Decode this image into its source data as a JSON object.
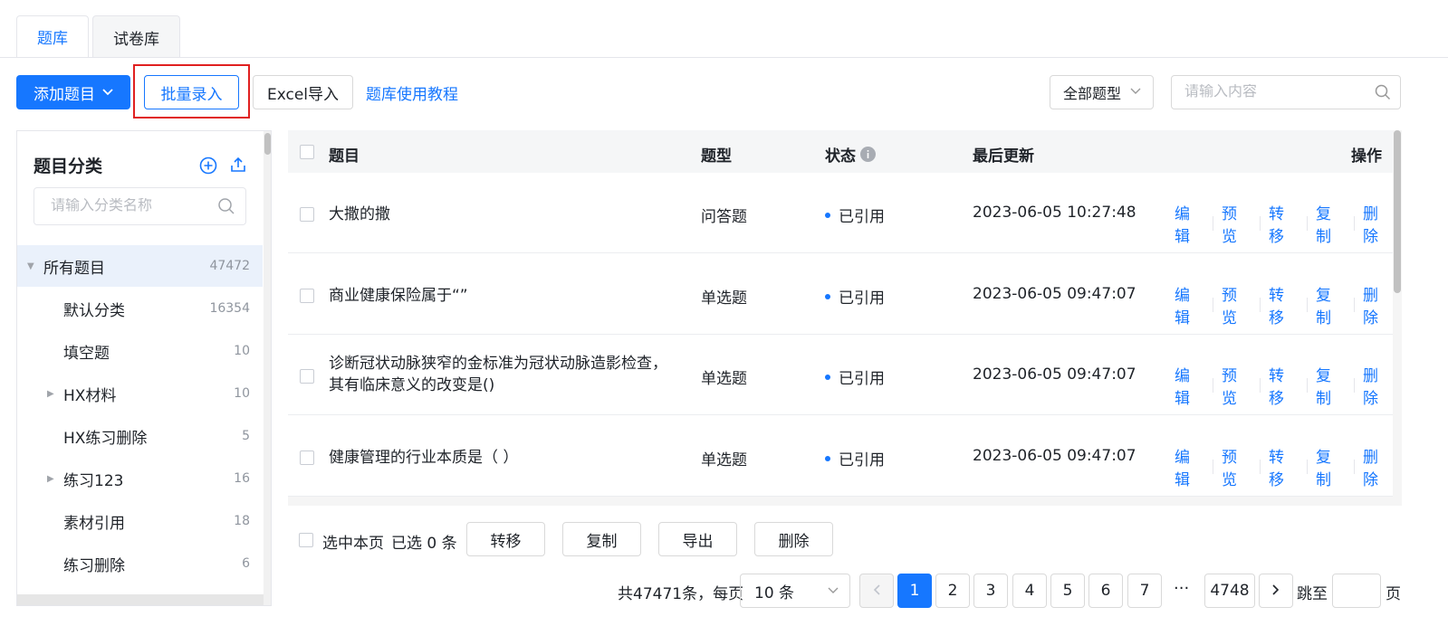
{
  "tabs": [
    {
      "label": "题库",
      "active": true
    },
    {
      "label": "试卷库",
      "active": false
    }
  ],
  "toolbar": {
    "add_label": "添加题目",
    "batch_label": "批量录入",
    "excel_label": "Excel导入",
    "tutorial_label": "题库使用教程",
    "type_filter": "全部题型",
    "search_placeholder": "请输入内容"
  },
  "sidebar": {
    "title": "题目分类",
    "search_placeholder": "请输入分类名称",
    "items": [
      {
        "label": "所有题目",
        "count": "47472"
      },
      {
        "label": "默认分类",
        "count": "16354"
      },
      {
        "label": "填空题",
        "count": "10"
      },
      {
        "label": "HX材料",
        "count": "10"
      },
      {
        "label": "HX练习删除",
        "count": "5"
      },
      {
        "label": "练习123",
        "count": "16"
      },
      {
        "label": "素材引用",
        "count": "18"
      },
      {
        "label": "练习删除",
        "count": "6"
      }
    ]
  },
  "table": {
    "headers": {
      "title": "题目",
      "type": "题型",
      "status": "状态",
      "updated": "最后更新",
      "ops": "操作"
    },
    "rows": [
      {
        "title": "大撒的撒",
        "type": "问答题",
        "status": "已引用",
        "updated": "2023-06-05 10:27:48"
      },
      {
        "title": "商业健康保险属于“”",
        "type": "单选题",
        "status": "已引用",
        "updated": "2023-06-05 09:47:07"
      },
      {
        "title": "诊断冠状动脉狭窄的金标准为冠状动脉造影检查，其有临床意义的改变是()",
        "type": "单选题",
        "status": "已引用",
        "updated": "2023-06-05 09:47:07"
      },
      {
        "title": "健康管理的行业本质是（ ）",
        "type": "单选题",
        "status": "已引用",
        "updated": "2023-06-05 09:47:07"
      }
    ],
    "ops": [
      "编辑",
      "预览",
      "转移",
      "复制",
      "删除"
    ]
  },
  "footer": {
    "select_page": "选中本页",
    "selected_count": "已选 0 条",
    "transfer": "转移",
    "copy": "复制",
    "export": "导出",
    "delete": "删除"
  },
  "pagination": {
    "total_text": "共47471条，每页",
    "page_size": "10 条",
    "pages": [
      "1",
      "2",
      "3",
      "4",
      "5",
      "6",
      "7"
    ],
    "ellipsis": "···",
    "last_page": "4748",
    "current": "1",
    "jump_to": "跳至",
    "page_unit": "页"
  },
  "colors": {
    "primary": "#1677ff",
    "highlight_frame": "#e02020"
  }
}
